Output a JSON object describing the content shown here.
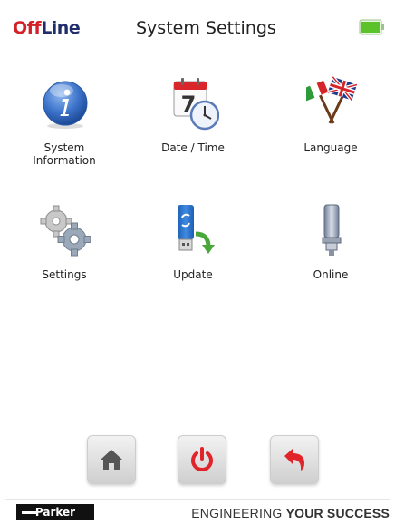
{
  "header": {
    "mode_part1": "Off",
    "mode_part2": "Line",
    "title": "System Settings",
    "battery_icon": "battery-icon"
  },
  "menu": {
    "items": [
      {
        "label": "System\nInformation",
        "icon": "info-icon"
      },
      {
        "label": "Date / Time",
        "icon": "calendar-clock-icon"
      },
      {
        "label": "Language",
        "icon": "flags-icon"
      },
      {
        "label": "Settings",
        "icon": "gears-icon"
      },
      {
        "label": "Update",
        "icon": "usb-update-icon"
      },
      {
        "label": "Online",
        "icon": "sensor-icon"
      }
    ]
  },
  "calendar": {
    "day": "7"
  },
  "nav": {
    "home_icon": "home-icon",
    "power_icon": "power-icon",
    "back_icon": "back-icon"
  },
  "footer": {
    "brand": "Parker",
    "tagline_part1": "ENGINEERING ",
    "tagline_part2": "YOUR SUCCESS"
  },
  "colors": {
    "mode_off": "#d42027",
    "mode_line": "#1f2d6b",
    "battery": "#5cc22a"
  }
}
